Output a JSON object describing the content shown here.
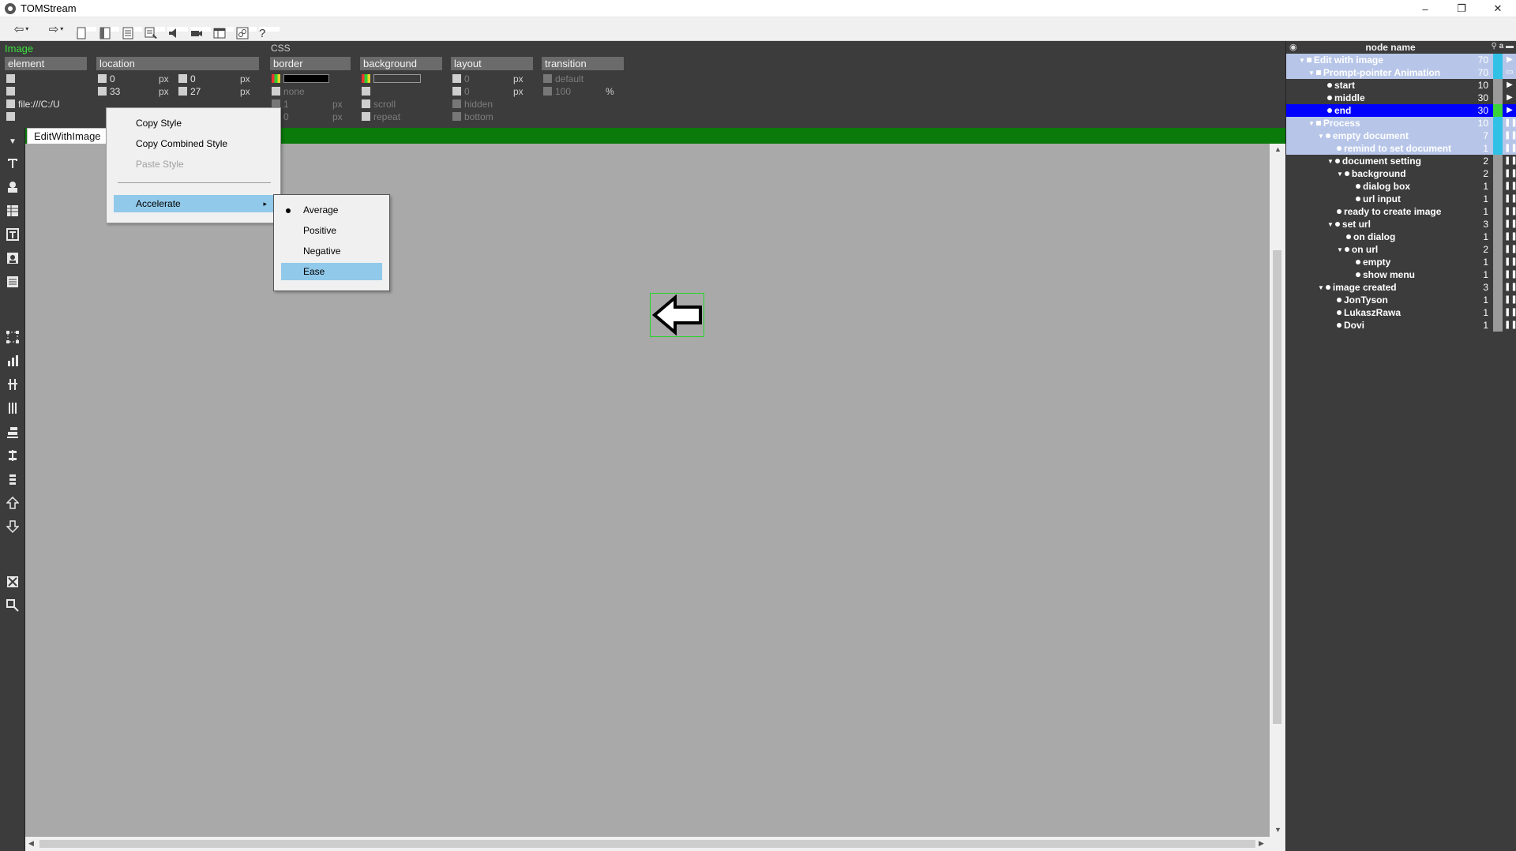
{
  "window": {
    "title": "TOMStream",
    "minimize": "–",
    "restore": "❐",
    "close": "✕"
  },
  "toolbar": {
    "back": "⇦",
    "forward": "⇨",
    "help": "?",
    "caret": "▾"
  },
  "props": {
    "section": "Image",
    "css": "CSS",
    "headers": {
      "element": "element",
      "location": "location",
      "border": "border",
      "background": "background",
      "layout": "layout",
      "transition": "transition"
    },
    "element": {
      "src": "file:///C:/U"
    },
    "location": {
      "left": "0",
      "top": "33",
      "right": "0",
      "bottom": "27",
      "unit": "px"
    },
    "border": {
      "style": "none",
      "width": "1",
      "radius": "0",
      "unit": "px"
    },
    "background": {
      "attachment": "scroll",
      "repeat": "repeat"
    },
    "layout": {
      "x": "0",
      "y": "0",
      "overflow": "hidden",
      "position": "bottom",
      "unit": "px"
    },
    "transition": {
      "timing": "default",
      "duration": "100",
      "unit": "%"
    }
  },
  "tab": {
    "label": "EditWithImage"
  },
  "context_menu": {
    "items": [
      "Copy Style",
      "Copy Combined Style",
      "Paste Style",
      "Accelerate"
    ],
    "sub_arrow": "▸"
  },
  "submenu": {
    "items": [
      "Average",
      "Positive",
      "Negative",
      "Ease"
    ],
    "checked": "Average",
    "highlighted": "Ease"
  },
  "tree": {
    "header": "node name",
    "nodes": [
      {
        "label": "Edit with image",
        "count": "70"
      },
      {
        "label": "Prompt-pointer Animation",
        "count": "70"
      },
      {
        "label": "start",
        "count": "10"
      },
      {
        "label": "middle",
        "count": "30"
      },
      {
        "label": "end",
        "count": "30"
      },
      {
        "label": "Process",
        "count": "10"
      },
      {
        "label": "empty document",
        "count": "7"
      },
      {
        "label": "remind to set document",
        "count": "1"
      },
      {
        "label": "document setting",
        "count": "2"
      },
      {
        "label": "background",
        "count": "2"
      },
      {
        "label": "dialog box",
        "count": "1"
      },
      {
        "label": "url input",
        "count": "1"
      },
      {
        "label": "ready to create image",
        "count": "1"
      },
      {
        "label": "set url",
        "count": "3"
      },
      {
        "label": "on dialog",
        "count": "1"
      },
      {
        "label": "on url",
        "count": "2"
      },
      {
        "label": "empty",
        "count": "1"
      },
      {
        "label": "show menu",
        "count": "1"
      },
      {
        "label": "image created",
        "count": "3"
      },
      {
        "label": "JonTyson",
        "count": "1"
      },
      {
        "label": "LukaszRawa",
        "count": "1"
      },
      {
        "label": "Dovi",
        "count": "1"
      }
    ]
  },
  "colors": {
    "accent_green": "#3be13b",
    "tab_bar": "#0a7a0a",
    "selection": "#91c9ea",
    "tree_selected": "#b7c6e8",
    "tree_active": "#0000ff"
  }
}
